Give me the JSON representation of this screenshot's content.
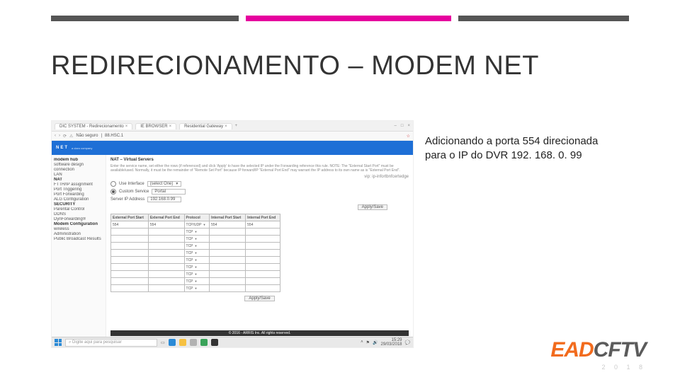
{
  "headline": "REDIRECIONAMENTO – MODEM NET",
  "caption_line1": "Adicionando a porta 554 direcionada",
  "caption_line2": "para o IP do DVR 192. 168. 0. 99",
  "brand": {
    "a": "EAD",
    "b": "CFTV",
    "sub": "2 0 1 8"
  },
  "browser": {
    "tabs": [
      {
        "label": "DIC SYSTEM - Redirecionamento"
      },
      {
        "label": "IE BROWSER"
      },
      {
        "label": "Residential Gateway"
      }
    ],
    "addr_prefix": "Não seguro",
    "url": "88.HSC.1",
    "window_controls": [
      "–",
      "□",
      "×"
    ]
  },
  "modem": {
    "logo": "NET",
    "sidebar": [
      {
        "label": "modem hub",
        "head": true
      },
      {
        "label": "software design"
      },
      {
        "label": "connection"
      },
      {
        "label": "LAN"
      },
      {
        "label": "NAT",
        "head": true
      },
      {
        "label": "FTTH/IP assignment"
      },
      {
        "label": "Port Triggering"
      },
      {
        "label": "Port Forwarding"
      },
      {
        "label": "ALG Configuration"
      },
      {
        "label": "SECURITY",
        "head": true
      },
      {
        "label": "Parental Control"
      },
      {
        "label": "DDNS"
      },
      {
        "label": "DynForwarding®"
      },
      {
        "label": "Modem Configuration",
        "head": true
      },
      {
        "label": "wireless"
      },
      {
        "label": "Administration"
      },
      {
        "label": "Public Broadcast Results"
      }
    ],
    "page_title": "NAT – Virtual Servers",
    "blurb": "Enter the service name, set either the rows (if referenced) and click 'Apply' to have the selected IP under the Forwarding reference this rule. NOTE: The \"External Start Port\" must be available/used. Normally, it must be the remainder of \"Remote Set Port\" because IP forward/IP \"External Port End\" may warrant the IP address to its own name as is \"External Port End\".",
    "vip_label": "vip:",
    "vip_value": "ip-infortbnfcertedge",
    "select": {
      "label": "Use Interface",
      "value": "(select One)"
    },
    "custom": {
      "radio_label": "Custom Service",
      "value": "Portal"
    },
    "server_ip": {
      "label": "Server IP Address",
      "value": "192.168.0.99"
    },
    "add_btn": "Apply/Save",
    "apply_btn": "Apply/Save",
    "table": {
      "headers": [
        "External Port Start",
        "External Port End",
        "Protocol",
        "Internal Port Start",
        "Internal Port End"
      ],
      "rows": [
        {
          "es": "554",
          "ee": "554",
          "proto": "TCP/UDP",
          "is": "554",
          "ie": "554"
        },
        {
          "es": "",
          "ee": "",
          "proto": "TCP",
          "is": "",
          "ie": ""
        },
        {
          "es": "",
          "ee": "",
          "proto": "TCP",
          "is": "",
          "ie": ""
        },
        {
          "es": "",
          "ee": "",
          "proto": "TCP",
          "is": "",
          "ie": ""
        },
        {
          "es": "",
          "ee": "",
          "proto": "TCP",
          "is": "",
          "ie": ""
        },
        {
          "es": "",
          "ee": "",
          "proto": "TCP",
          "is": "",
          "ie": ""
        },
        {
          "es": "",
          "ee": "",
          "proto": "TCP",
          "is": "",
          "ie": ""
        },
        {
          "es": "",
          "ee": "",
          "proto": "TCP",
          "is": "",
          "ie": ""
        },
        {
          "es": "",
          "ee": "",
          "proto": "TCP",
          "is": "",
          "ie": ""
        },
        {
          "es": "",
          "ee": "",
          "proto": "TCP",
          "is": "",
          "ie": ""
        }
      ]
    },
    "footer": "© 2016 - ARRIS Inc.  All rights reserved."
  },
  "taskbar": {
    "search_placeholder": "Digite aqui para pesquisar",
    "time": "15:29",
    "date": "29/03/2018"
  }
}
